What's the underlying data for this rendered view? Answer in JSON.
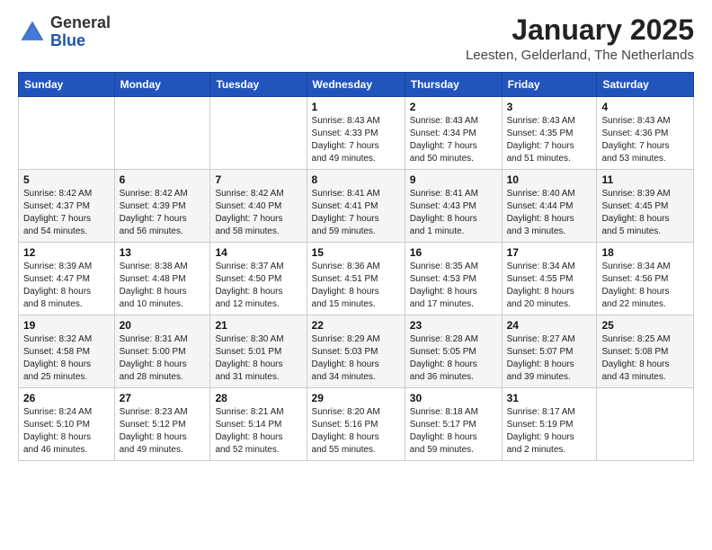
{
  "header": {
    "logo_general": "General",
    "logo_blue": "Blue",
    "month": "January 2025",
    "location": "Leesten, Gelderland, The Netherlands"
  },
  "weekdays": [
    "Sunday",
    "Monday",
    "Tuesday",
    "Wednesday",
    "Thursday",
    "Friday",
    "Saturday"
  ],
  "weeks": [
    [
      {
        "day": "",
        "info": ""
      },
      {
        "day": "",
        "info": ""
      },
      {
        "day": "",
        "info": ""
      },
      {
        "day": "1",
        "info": "Sunrise: 8:43 AM\nSunset: 4:33 PM\nDaylight: 7 hours\nand 49 minutes."
      },
      {
        "day": "2",
        "info": "Sunrise: 8:43 AM\nSunset: 4:34 PM\nDaylight: 7 hours\nand 50 minutes."
      },
      {
        "day": "3",
        "info": "Sunrise: 8:43 AM\nSunset: 4:35 PM\nDaylight: 7 hours\nand 51 minutes."
      },
      {
        "day": "4",
        "info": "Sunrise: 8:43 AM\nSunset: 4:36 PM\nDaylight: 7 hours\nand 53 minutes."
      }
    ],
    [
      {
        "day": "5",
        "info": "Sunrise: 8:42 AM\nSunset: 4:37 PM\nDaylight: 7 hours\nand 54 minutes."
      },
      {
        "day": "6",
        "info": "Sunrise: 8:42 AM\nSunset: 4:39 PM\nDaylight: 7 hours\nand 56 minutes."
      },
      {
        "day": "7",
        "info": "Sunrise: 8:42 AM\nSunset: 4:40 PM\nDaylight: 7 hours\nand 58 minutes."
      },
      {
        "day": "8",
        "info": "Sunrise: 8:41 AM\nSunset: 4:41 PM\nDaylight: 7 hours\nand 59 minutes."
      },
      {
        "day": "9",
        "info": "Sunrise: 8:41 AM\nSunset: 4:43 PM\nDaylight: 8 hours\nand 1 minute."
      },
      {
        "day": "10",
        "info": "Sunrise: 8:40 AM\nSunset: 4:44 PM\nDaylight: 8 hours\nand 3 minutes."
      },
      {
        "day": "11",
        "info": "Sunrise: 8:39 AM\nSunset: 4:45 PM\nDaylight: 8 hours\nand 5 minutes."
      }
    ],
    [
      {
        "day": "12",
        "info": "Sunrise: 8:39 AM\nSunset: 4:47 PM\nDaylight: 8 hours\nand 8 minutes."
      },
      {
        "day": "13",
        "info": "Sunrise: 8:38 AM\nSunset: 4:48 PM\nDaylight: 8 hours\nand 10 minutes."
      },
      {
        "day": "14",
        "info": "Sunrise: 8:37 AM\nSunset: 4:50 PM\nDaylight: 8 hours\nand 12 minutes."
      },
      {
        "day": "15",
        "info": "Sunrise: 8:36 AM\nSunset: 4:51 PM\nDaylight: 8 hours\nand 15 minutes."
      },
      {
        "day": "16",
        "info": "Sunrise: 8:35 AM\nSunset: 4:53 PM\nDaylight: 8 hours\nand 17 minutes."
      },
      {
        "day": "17",
        "info": "Sunrise: 8:34 AM\nSunset: 4:55 PM\nDaylight: 8 hours\nand 20 minutes."
      },
      {
        "day": "18",
        "info": "Sunrise: 8:34 AM\nSunset: 4:56 PM\nDaylight: 8 hours\nand 22 minutes."
      }
    ],
    [
      {
        "day": "19",
        "info": "Sunrise: 8:32 AM\nSunset: 4:58 PM\nDaylight: 8 hours\nand 25 minutes."
      },
      {
        "day": "20",
        "info": "Sunrise: 8:31 AM\nSunset: 5:00 PM\nDaylight: 8 hours\nand 28 minutes."
      },
      {
        "day": "21",
        "info": "Sunrise: 8:30 AM\nSunset: 5:01 PM\nDaylight: 8 hours\nand 31 minutes."
      },
      {
        "day": "22",
        "info": "Sunrise: 8:29 AM\nSunset: 5:03 PM\nDaylight: 8 hours\nand 34 minutes."
      },
      {
        "day": "23",
        "info": "Sunrise: 8:28 AM\nSunset: 5:05 PM\nDaylight: 8 hours\nand 36 minutes."
      },
      {
        "day": "24",
        "info": "Sunrise: 8:27 AM\nSunset: 5:07 PM\nDaylight: 8 hours\nand 39 minutes."
      },
      {
        "day": "25",
        "info": "Sunrise: 8:25 AM\nSunset: 5:08 PM\nDaylight: 8 hours\nand 43 minutes."
      }
    ],
    [
      {
        "day": "26",
        "info": "Sunrise: 8:24 AM\nSunset: 5:10 PM\nDaylight: 8 hours\nand 46 minutes."
      },
      {
        "day": "27",
        "info": "Sunrise: 8:23 AM\nSunset: 5:12 PM\nDaylight: 8 hours\nand 49 minutes."
      },
      {
        "day": "28",
        "info": "Sunrise: 8:21 AM\nSunset: 5:14 PM\nDaylight: 8 hours\nand 52 minutes."
      },
      {
        "day": "29",
        "info": "Sunrise: 8:20 AM\nSunset: 5:16 PM\nDaylight: 8 hours\nand 55 minutes."
      },
      {
        "day": "30",
        "info": "Sunrise: 8:18 AM\nSunset: 5:17 PM\nDaylight: 8 hours\nand 59 minutes."
      },
      {
        "day": "31",
        "info": "Sunrise: 8:17 AM\nSunset: 5:19 PM\nDaylight: 9 hours\nand 2 minutes."
      },
      {
        "day": "",
        "info": ""
      }
    ]
  ]
}
